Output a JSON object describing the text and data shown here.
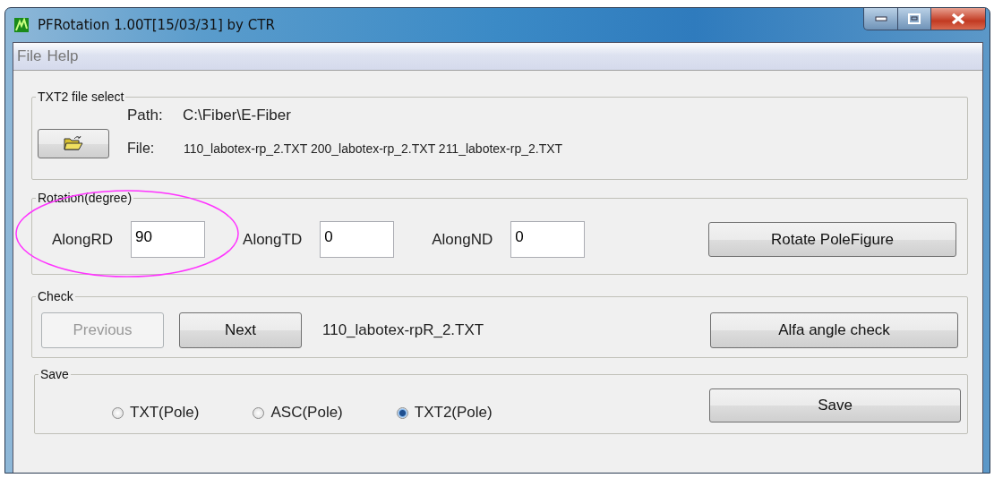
{
  "window": {
    "title": "PFRotation 1.00T[15/03/31] by CTR"
  },
  "menu": [
    "File",
    "Help"
  ],
  "file_select": {
    "title": "TXT2 file select",
    "path_label": "Path:",
    "path": "C:\\Fiber\\E-Fiber",
    "file_label": "File:",
    "files": "110_labotex-rp_2.TXT 200_labotex-rp_2.TXT 211_labotex-rp_2.TXT"
  },
  "rotation": {
    "title": "Rotation(degree)",
    "fields": [
      {
        "label": "AlongRD",
        "value": "90"
      },
      {
        "label": "AlongTD",
        "value": "0"
      },
      {
        "label": "AlongND",
        "value": "0"
      }
    ],
    "button": "Rotate PoleFigure"
  },
  "check": {
    "title": "Check",
    "buttons": [
      {
        "label": "Previous",
        "disabled": true
      },
      {
        "label": "Next",
        "disabled": false
      }
    ],
    "current_file": "110_labotex-rpR_2.TXT",
    "button": "Alfa angle check"
  },
  "save": {
    "title": "Save",
    "options": [
      {
        "label": "TXT(Pole)",
        "selected": false
      },
      {
        "label": "ASC(Pole)",
        "selected": false
      },
      {
        "label": "TXT2(Pole)",
        "selected": true
      }
    ],
    "button": "Save"
  }
}
